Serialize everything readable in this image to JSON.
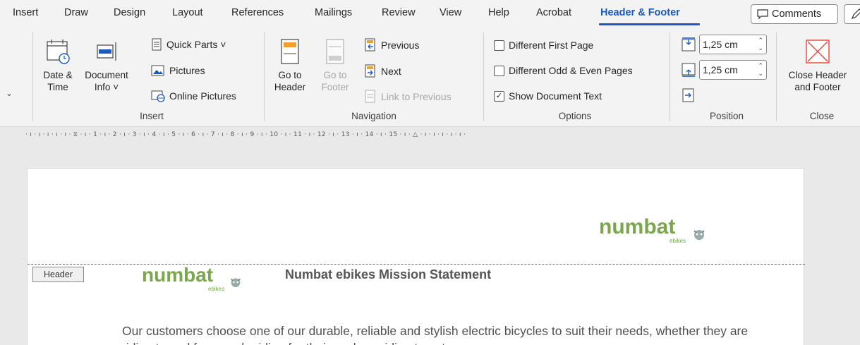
{
  "tabs": [
    {
      "label": "Insert"
    },
    {
      "label": "Draw"
    },
    {
      "label": "Design"
    },
    {
      "label": "Layout"
    },
    {
      "label": "References"
    },
    {
      "label": "Mailings"
    },
    {
      "label": "Review"
    },
    {
      "label": "View"
    },
    {
      "label": "Help"
    },
    {
      "label": "Acrobat"
    },
    {
      "label": "Header & Footer"
    }
  ],
  "active_tab": "Header & Footer",
  "comments_label": "Comments",
  "ribbon": {
    "insert": {
      "date_time": "Date &\nTime",
      "date_time_l1": "Date &",
      "date_time_l2": "Time",
      "doc_info_l1": "Document",
      "doc_info_l2": "Info ˅",
      "quick_parts": "Quick Parts ˅",
      "pictures": "Pictures",
      "online_pictures": "Online Pictures",
      "label": "Insert"
    },
    "navigation": {
      "go_to_header_l1": "Go to",
      "go_to_header_l2": "Header",
      "go_to_footer_l1": "Go to",
      "go_to_footer_l2": "Footer",
      "previous": "Previous",
      "next": "Next",
      "link_to_previous": "Link to Previous",
      "label": "Navigation"
    },
    "options": {
      "different_first_page": "Different First Page",
      "different_odd_even": "Different Odd & Even Pages",
      "show_document_text": "Show Document Text",
      "show_document_text_checked": true,
      "label": "Options"
    },
    "position": {
      "header_from_top": "1,25 cm",
      "footer_from_bottom": "1,25 cm",
      "label": "Position"
    },
    "close": {
      "close_l1": "Close Header",
      "close_l2": "and Footer",
      "label": "Close"
    }
  },
  "ruler": "· ı · ı · ı · ı · ı · ⧖ · ı · 1 · ı · 2 · ı · 3 · ı · 4 · ı · 5 · ı · 6 · ı · 7 · ı · 8 · ı · 9 · ı · 10 · ı · 11 · ı · 12 · ı · 13 · ı · 14 · ı · 15 · ı · △ · ı · ı · ı · ı · ı ·",
  "document": {
    "header_tag": "Header",
    "logo_text": "numbat",
    "logo_sub": "ebikes",
    "title": "Numbat ebikes Mission Statement",
    "body": "Our customers choose one of our durable, reliable and stylish electric bicycles to suit their needs, whether they are riding to and from work, riding for their work, or riding to get away"
  },
  "colors": {
    "accent": "#185abd",
    "logo_green": "#7aa64d",
    "close_red": "#e0463c"
  }
}
